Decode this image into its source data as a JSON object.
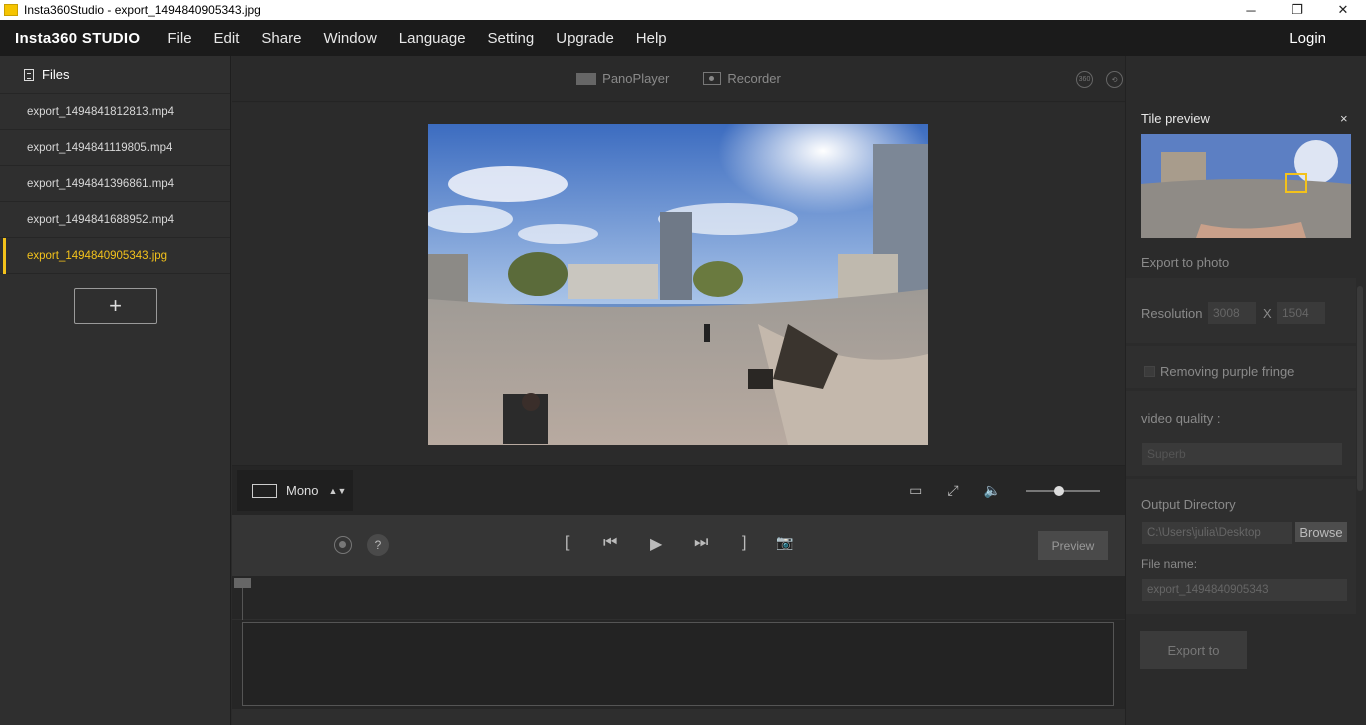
{
  "window": {
    "title": "Insta360Studio - export_1494840905343.jpg",
    "buttons": [
      "─",
      "❐",
      "✕"
    ]
  },
  "menubar": {
    "brand": "Insta360 STUDIO",
    "items": [
      "File",
      "Edit",
      "Share",
      "Window",
      "Language",
      "Setting",
      "Upgrade",
      "Help"
    ],
    "login": "Login"
  },
  "sidebar": {
    "header": "Files",
    "files": [
      {
        "name": "export_1494841812813.mp4",
        "active": false
      },
      {
        "name": "export_1494841119805.mp4",
        "active": false
      },
      {
        "name": "export_1494841396861.mp4",
        "active": false
      },
      {
        "name": "export_1494841688952.mp4",
        "active": false
      },
      {
        "name": "export_1494840905343.jpg",
        "active": true
      }
    ],
    "add_label": "+"
  },
  "toolbar": {
    "panoplayer": "PanoPlayer",
    "recorder": "Recorder",
    "icon_360": "360",
    "icon_rotate": "⟲"
  },
  "controls": {
    "view_mode": "Mono",
    "updown": "▲▼",
    "help": "?",
    "bracket_in": "[",
    "prev": "⏮",
    "play": "▶",
    "next": "⏭",
    "bracket_out": "]",
    "camera": "📷",
    "preview": "Preview",
    "volume_level": 0.45
  },
  "right_panel": {
    "title": "Tile preview",
    "close": "×",
    "export_to_photo": "Export to photo",
    "resolution_label": "Resolution",
    "res_width": "3008",
    "res_x": "X",
    "res_height": "1504",
    "purple_fringe": "Removing purple fringe",
    "video_quality_label": "video quality :",
    "video_quality_value": "Superb",
    "output_dir_label": "Output Directory",
    "output_dir_value": "C:\\Users\\julia\\Desktop",
    "browse": "Browse",
    "file_name_label": "File name:",
    "file_name_value": "export_1494840905343",
    "export_button": "Export to"
  },
  "colors": {
    "accent": "#f3c21b",
    "menubar_bg": "#1b1b1b",
    "panel_bg": "#2f2f2f"
  }
}
